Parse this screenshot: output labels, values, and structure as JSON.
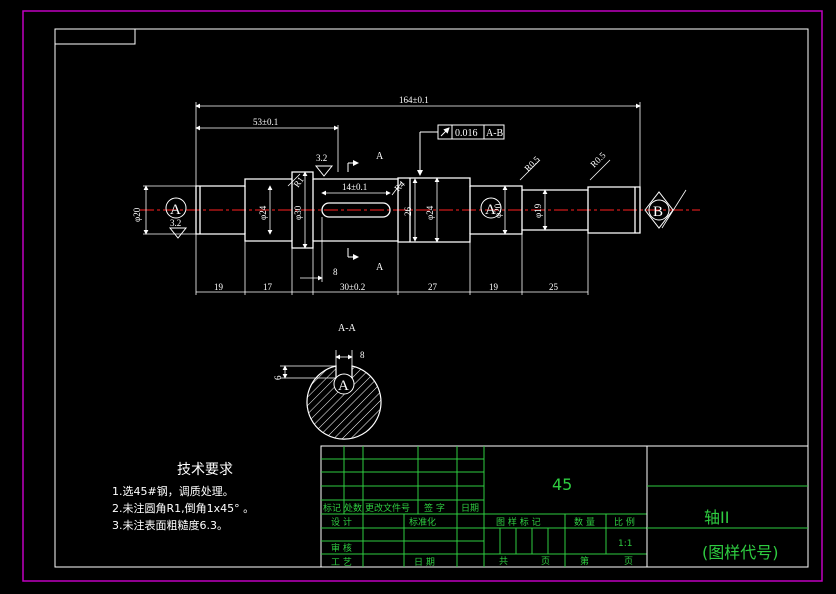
{
  "drawing": {
    "dims": {
      "total_length": "164±0.1",
      "left_to_shoulder": "53±0.1",
      "keyway_length": "14±0.1",
      "keyway_offset": "8",
      "seg_19a": "19",
      "seg_17": "17",
      "seg_30": "30±0.2",
      "seg_27": "27",
      "seg_19b": "19",
      "seg_25": "25",
      "dia_20": "φ20",
      "dia_24a": "φ24",
      "dia_30": "φ30",
      "dia_26": "26",
      "dia_24b": "φ24",
      "dia_20b": "φ20",
      "dia_19": "φ19",
      "radius_r1": "R1",
      "radius_r4": "R4",
      "radius_r05a": "R0.5",
      "radius_r05b": "R0.5"
    },
    "tolerance": {
      "value": "0.016",
      "datum": "A-B"
    },
    "roughness": {
      "ra_32": "3.2",
      "ra_32b": "3.2"
    },
    "datums": {
      "a": "A",
      "b": "B"
    },
    "section": {
      "cut_mark_top": "A",
      "cut_mark_bottom": "A",
      "title": "A-A",
      "key_width": "8",
      "key_depth": "6"
    }
  },
  "tech_requirements": {
    "title": "技术要求",
    "items": [
      "1.选45#钢，调质处理。",
      "2.未注圆角R1,倒角1x45° 。",
      "3.未注表面粗糙度6.3。"
    ]
  },
  "title_block": {
    "material": "45",
    "part_name": "轴II",
    "drawing_no": "(图样代号)",
    "labels": {
      "mark": "标记",
      "count": "处数",
      "change_doc": "更改文件号",
      "sign": "签 字",
      "date": "日期",
      "design": "设 计",
      "standardize": "标准化",
      "stage_mark": "图 样 标 记",
      "weight": "数 量",
      "scale": "比 例",
      "scale_value": "1:1",
      "review": "审 核",
      "process": "工 艺",
      "date2": "日 期",
      "total": "共",
      "page": "页",
      "sheet": "第",
      "page2": "页"
    }
  },
  "colors": {
    "background": "#000000",
    "outer_frame": "#c000c0",
    "drawing_lines": "#ffffff",
    "table_lines": "#2ecc40",
    "centerline": "#ff2020"
  }
}
